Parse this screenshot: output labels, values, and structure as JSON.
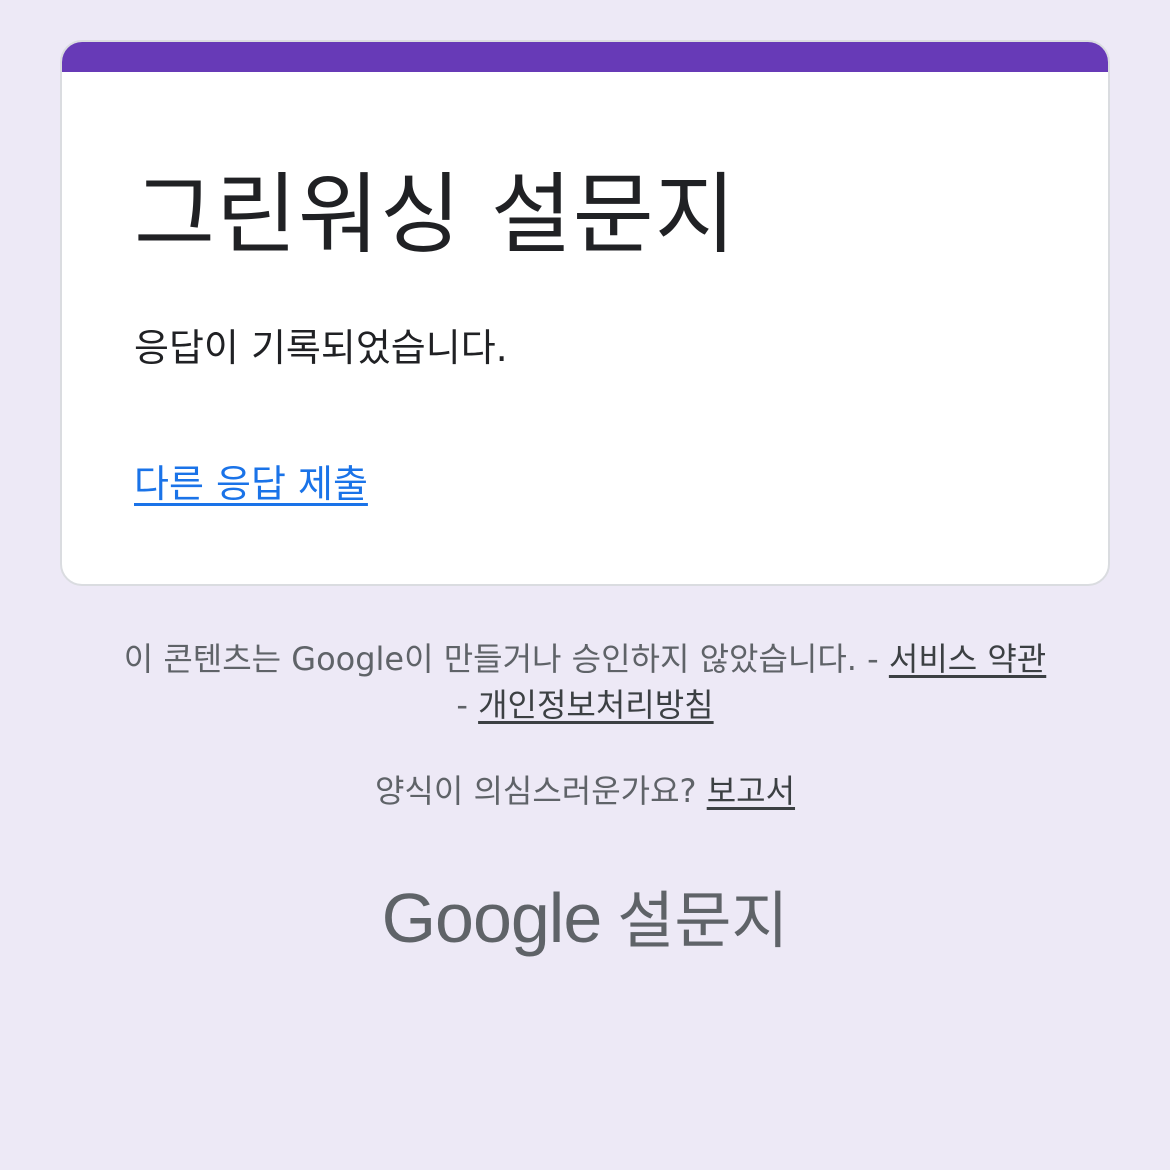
{
  "form": {
    "title": "그린워싱 설문지",
    "confirmation_message": "응답이 기록되었습니다.",
    "submit_another_label": "다른 응답 제출"
  },
  "footer": {
    "disclaimer_text": "이 콘텐츠는 Google이 만들거나 승인하지 않았습니다. - ",
    "terms_label": "서비스 약관",
    "separator": " - ",
    "privacy_label": "개인정보처리방침",
    "report_prompt": "양식이 의심스러운가요? ",
    "report_label": "보고서",
    "logo_word": "Google",
    "logo_product": "설문지"
  },
  "colors": {
    "accent": "#673ab7",
    "background": "#ede9f6",
    "link": "#1a73e8"
  }
}
